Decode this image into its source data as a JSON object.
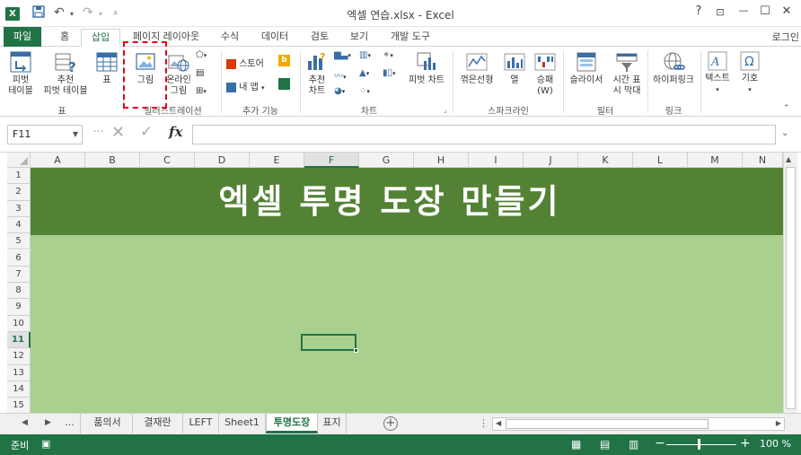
{
  "window": {
    "app_icon": "X",
    "title": "엑셀 연습.xlsx - Excel",
    "help": "?",
    "restore_ribbon": "⊡",
    "minimize": "—",
    "maximize": "☐",
    "close": "✕"
  },
  "tabs": [
    {
      "label": "파일"
    },
    {
      "label": "홈"
    },
    {
      "label": "삽입"
    },
    {
      "label": "페이지 레이아웃"
    },
    {
      "label": "수식"
    },
    {
      "label": "데이터"
    },
    {
      "label": "검토"
    },
    {
      "label": "보기"
    },
    {
      "label": "개발 도구"
    }
  ],
  "signin": "로그인",
  "ribbon": {
    "pivot_table": [
      "피벗",
      "테이블"
    ],
    "recommended_pivot": [
      "추천",
      "피벗 테이블"
    ],
    "table": "표",
    "group_tables": "표",
    "picture": "그림",
    "online_picture": [
      "온라인",
      "그림"
    ],
    "group_illustrations": "일러스트레이션",
    "store": "스토어",
    "my_apps": "내 앱",
    "group_addins": "추가 기능",
    "recommended_charts": [
      "추천",
      "차트"
    ],
    "pivot_chart": "피벗 차트",
    "group_charts": "차트",
    "spark_line": "꺾은선형",
    "spark_column": "열",
    "spark_winloss": [
      "승패",
      "(W)"
    ],
    "group_sparklines": "스파크라인",
    "slicer": "슬라이서",
    "timeline": [
      "시간 표",
      "시 막대"
    ],
    "group_filters": "필터",
    "hyperlink": "하이퍼링크",
    "group_links": "링크",
    "text": "텍스트",
    "symbols": "기호"
  },
  "formula_bar": {
    "name_box": "F11",
    "fx": "fx",
    "value": ""
  },
  "grid": {
    "columns": [
      "A",
      "B",
      "C",
      "D",
      "E",
      "F",
      "G",
      "H",
      "I",
      "J",
      "K",
      "L",
      "M",
      "N"
    ],
    "selected_column": "F",
    "rows": [
      "1",
      "2",
      "3",
      "4",
      "5",
      "6",
      "7",
      "8",
      "9",
      "10",
      "11",
      "12",
      "13",
      "14",
      "15"
    ],
    "selected_row": "11",
    "banner_text": "엑셀 투명 도장 만들기",
    "banner_color": "#548235",
    "body_color": "#a9d08e"
  },
  "sheets": {
    "more": "...",
    "tabs": [
      "품의서",
      "결재란",
      "LEFT",
      "Sheet1",
      "투명도장",
      "표지"
    ],
    "active": "투명도장",
    "add": "+"
  },
  "status": {
    "ready": "준비",
    "zoom": "100 %",
    "accent": "#217346"
  }
}
